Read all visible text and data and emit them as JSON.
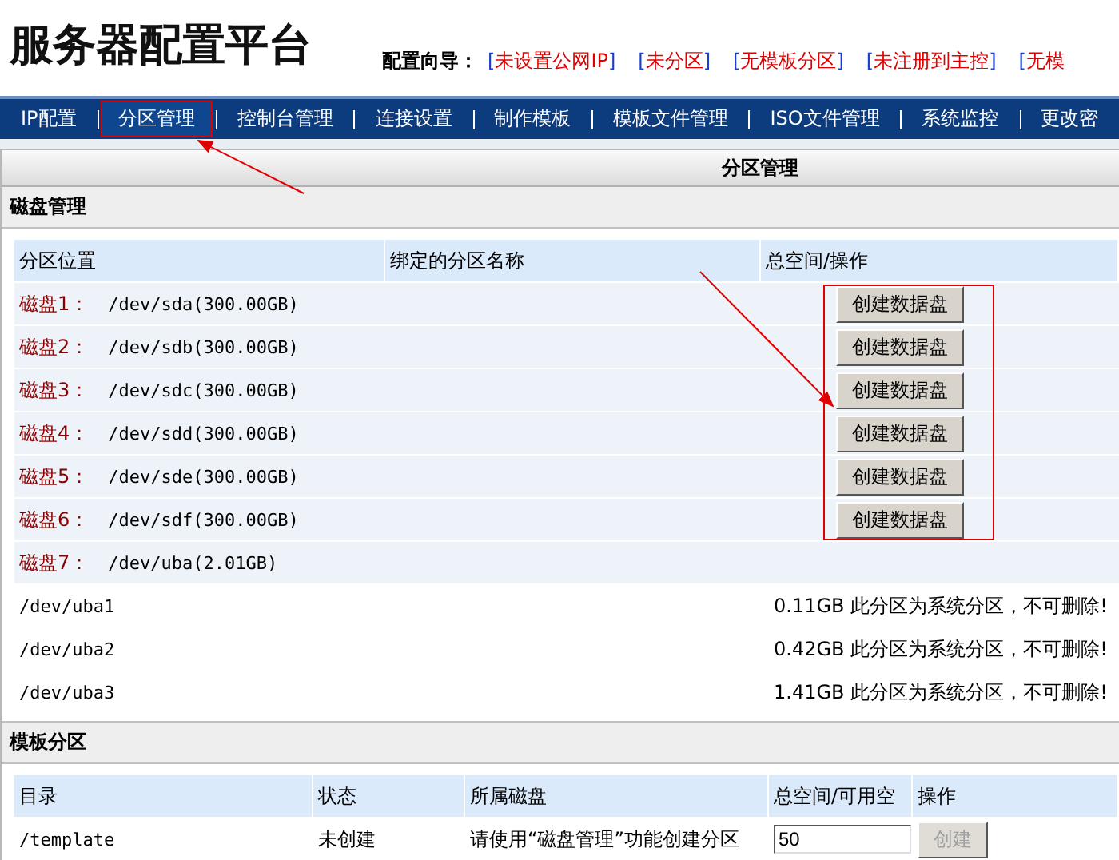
{
  "header": {
    "title": "服务器配置平台",
    "guide_label": "配置向导：",
    "guide_links": [
      {
        "open": "[",
        "label": "未设置公网IP",
        "close": "]"
      },
      {
        "open": "[",
        "label": "未分区",
        "close": "]"
      },
      {
        "open": "[",
        "label": "无模板分区",
        "close": "]"
      },
      {
        "open": "[",
        "label": "未注册到主控",
        "close": "]"
      },
      {
        "open": "[",
        "label": "无模"
      }
    ]
  },
  "nav": [
    {
      "label": "IP配置",
      "selected": false
    },
    {
      "label": "分区管理",
      "selected": true
    },
    {
      "label": "控制台管理",
      "selected": false
    },
    {
      "label": "连接设置",
      "selected": false
    },
    {
      "label": "制作模板",
      "selected": false
    },
    {
      "label": "模板文件管理",
      "selected": false
    },
    {
      "label": "ISO文件管理",
      "selected": false
    },
    {
      "label": "系统监控",
      "selected": false
    },
    {
      "label": "更改密",
      "selected": false
    }
  ],
  "panel_title": "分区管理",
  "disk_section": {
    "title": "磁盘管理",
    "columns": [
      "分区位置",
      "绑定的分区名称",
      "总空间/操作"
    ],
    "disks": [
      {
        "label": "磁盘1：",
        "device": "/dev/sda(300.00GB)",
        "action": "创建数据盘"
      },
      {
        "label": "磁盘2：",
        "device": "/dev/sdb(300.00GB)",
        "action": "创建数据盘"
      },
      {
        "label": "磁盘3：",
        "device": "/dev/sdc(300.00GB)",
        "action": "创建数据盘"
      },
      {
        "label": "磁盘4：",
        "device": "/dev/sdd(300.00GB)",
        "action": "创建数据盘"
      },
      {
        "label": "磁盘5：",
        "device": "/dev/sde(300.00GB)",
        "action": "创建数据盘"
      },
      {
        "label": "磁盘6：",
        "device": "/dev/sdf(300.00GB)",
        "action": "创建数据盘"
      },
      {
        "label": "磁盘7：",
        "device": "/dev/uba(2.01GB)"
      }
    ],
    "partitions": [
      {
        "path": "/dev/uba1",
        "info": "0.11GB 此分区为系统分区，不可删除!"
      },
      {
        "path": "/dev/uba2",
        "info": "0.42GB 此分区为系统分区，不可删除!"
      },
      {
        "path": "/dev/uba3",
        "info": "1.41GB 此分区为系统分区，不可删除!"
      }
    ]
  },
  "template_section": {
    "title": "模板分区",
    "columns": [
      "目录",
      "状态",
      "所属磁盘",
      "总空间/可用空",
      "操作"
    ],
    "rows": [
      {
        "dir": "/template",
        "status": "未创建",
        "disk": "请使用“磁盘管理”功能创建分区",
        "size": "50",
        "action": "创建",
        "disabled": true
      }
    ]
  }
}
